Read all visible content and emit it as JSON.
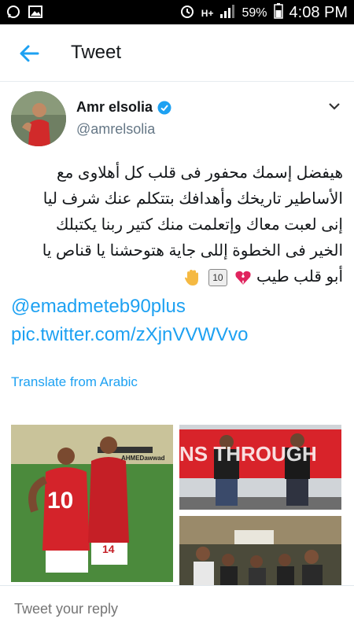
{
  "status_bar": {
    "battery": "59%",
    "time": "4:08 PM",
    "network": "H+",
    "icons": [
      "whatsapp-icon",
      "image-icon",
      "alarm-icon",
      "signal-icon",
      "battery-icon"
    ]
  },
  "app_bar": {
    "title": "Tweet",
    "back_icon": "back-arrow-icon"
  },
  "tweet": {
    "author_name": "Amr elsolia",
    "author_handle": "@amrelsolia",
    "verified": true,
    "text_lines": [
      "هيفضل إسمك محفور فى قلب كل أهلاوى مع",
      "الأساطير  تاريخك وأهدافك بتتكلم عنك شرف ليا",
      "إنى لعبت معاك وإتعلمت منك كتير ربنا يكتبلك",
      "الخير فى الخطوة إللى جاية هتوحشنا يا قناص يا",
      "أبو قلب طيب"
    ],
    "emoji_names": [
      "broken-heart-icon",
      "keycap-ten-icon",
      "raised-hand-icon"
    ],
    "keycap_text": "10",
    "mention": "@emadmeteb90plus",
    "pic_link": "pic.twitter.com/zXjnVVWVvo",
    "translate_label": "Translate from Arabic",
    "photo_captions": [
      "AHMEDawwad",
      "NS THROUGH"
    ],
    "jersey_number": "10",
    "jersey_number_2": "14"
  },
  "reply": {
    "placeholder": "Tweet your reply"
  },
  "colors": {
    "accent": "#1da1f2",
    "text": "#14171a",
    "muted": "#657786"
  }
}
